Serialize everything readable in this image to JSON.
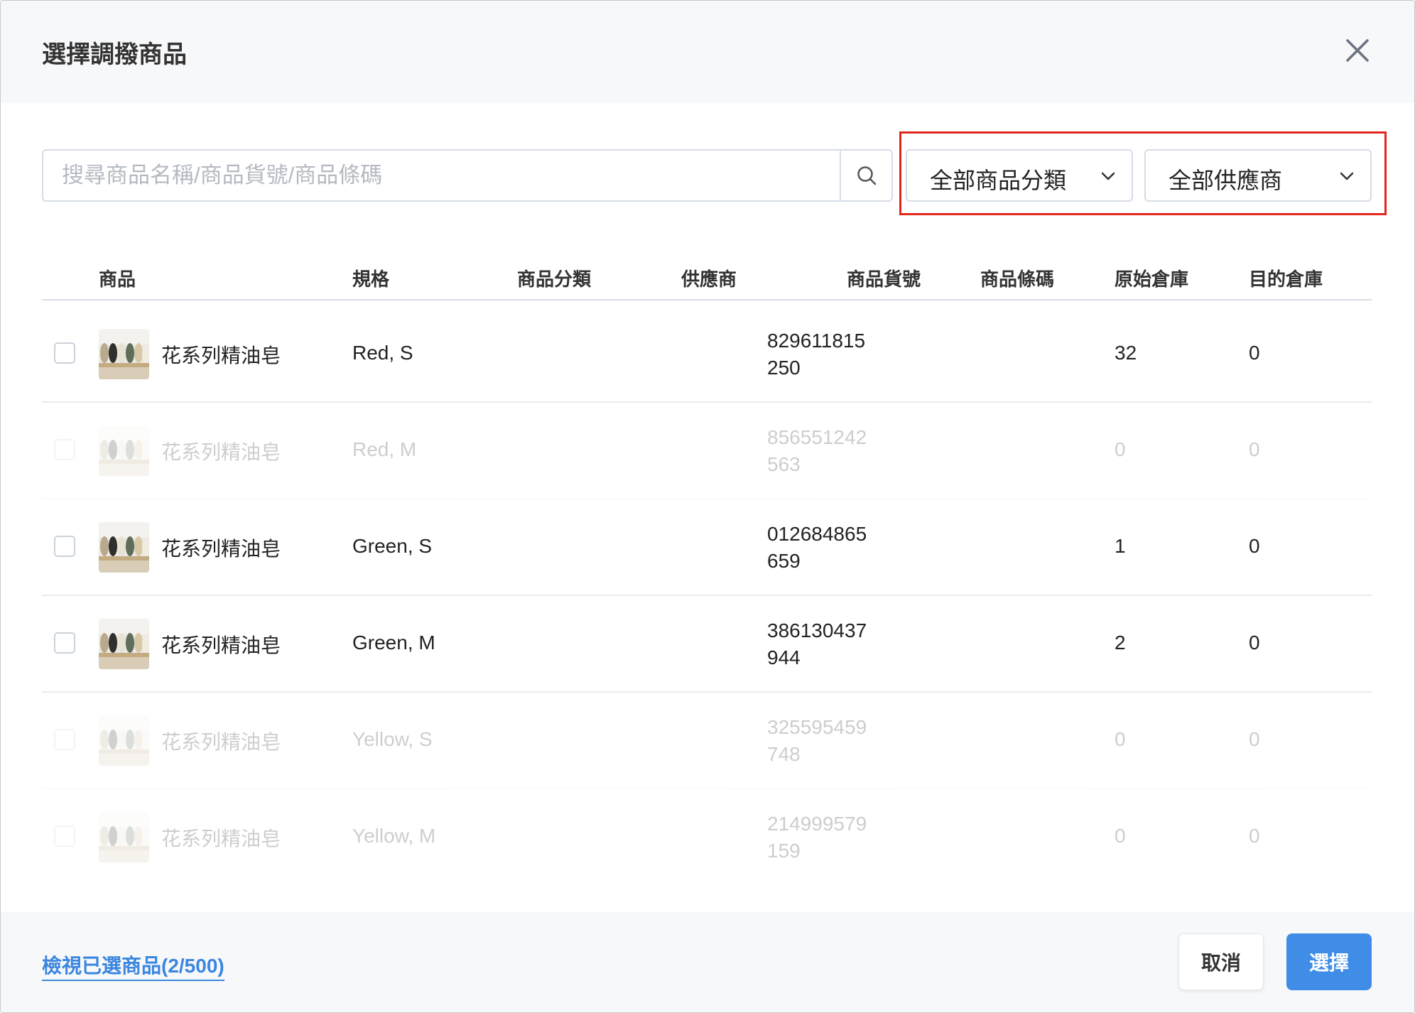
{
  "modal": {
    "title": "選擇調撥商品",
    "search_placeholder": "搜尋商品名稱/商品貨號/商品條碼",
    "category_filter": "全部商品分類",
    "supplier_filter": "全部供應商"
  },
  "table": {
    "headers": [
      "商品",
      "規格",
      "商品分類",
      "供應商",
      "商品貨號",
      "商品條碼",
      "原始倉庫",
      "目的倉庫"
    ],
    "rows": [
      {
        "name": "花系列精油皂",
        "spec": "Red, S",
        "barcode_1": "829611815",
        "barcode_2": "250",
        "source": "32",
        "target": "0",
        "enabled": true
      },
      {
        "name": "花系列精油皂",
        "spec": "Red, M",
        "barcode_1": "856551242",
        "barcode_2": "563",
        "source": "0",
        "target": "0",
        "enabled": false
      },
      {
        "name": "花系列精油皂",
        "spec": "Green, S",
        "barcode_1": "012684865",
        "barcode_2": "659",
        "source": "1",
        "target": "0",
        "enabled": true
      },
      {
        "name": "花系列精油皂",
        "spec": "Green, M",
        "barcode_1": "386130437",
        "barcode_2": "944",
        "source": "2",
        "target": "0",
        "enabled": true
      },
      {
        "name": "花系列精油皂",
        "spec": "Yellow, S",
        "barcode_1": "325595459",
        "barcode_2": "748",
        "source": "0",
        "target": "0",
        "enabled": false
      },
      {
        "name": "花系列精油皂",
        "spec": "Yellow, M",
        "barcode_1": "214999579",
        "barcode_2": "159",
        "source": "0",
        "target": "0",
        "enabled": false
      }
    ]
  },
  "footer": {
    "view_selected": "檢視已選商品(2/500)",
    "cancel": "取消",
    "confirm": "選擇"
  },
  "colors": {
    "highlight_border": "#e3251b",
    "primary": "#3f8de6",
    "link": "#3a86e0"
  },
  "icons": {
    "close": "close-icon",
    "search": "search-icon",
    "dropdown": "chevron-down-icon"
  }
}
